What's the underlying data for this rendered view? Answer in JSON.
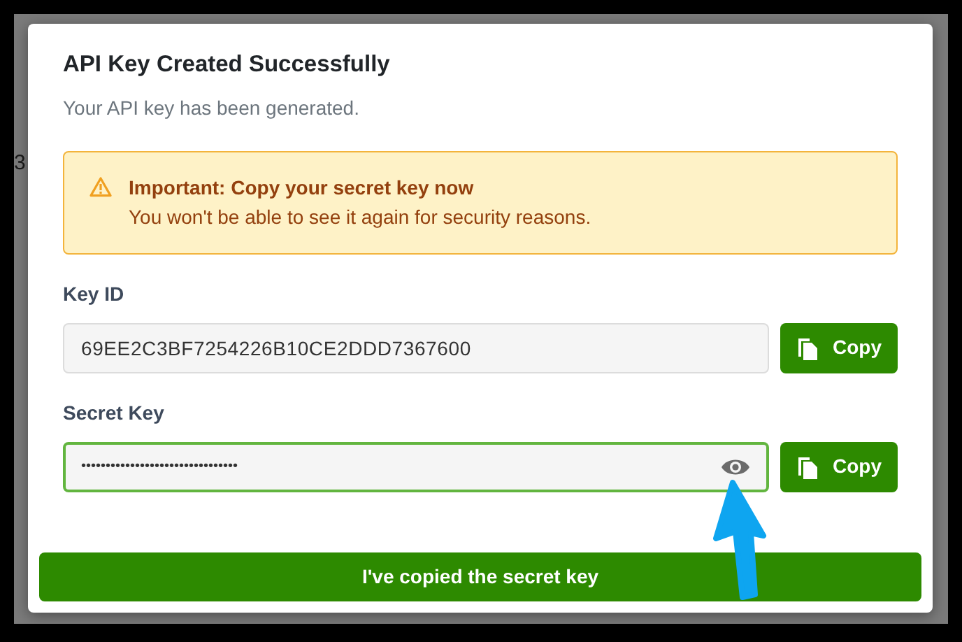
{
  "backdrop": {
    "fragment_text": "3"
  },
  "dialog": {
    "title": "API Key Created Successfully",
    "subtitle": "Your API key has been generated."
  },
  "alert": {
    "kind": "warning",
    "title": "Important: Copy your secret key now",
    "message": "You won't be able to see it again for security reasons."
  },
  "fields": [
    {
      "label": "Key ID",
      "value": "69EE2C3BF7254226B10CE2DDD7367600",
      "masked": false,
      "focused": false,
      "button": "Copy"
    },
    {
      "label": "Secret Key",
      "value": "••••••••••••••••••••••••••••••••",
      "masked": true,
      "focused": true,
      "button": "Copy"
    }
  ],
  "confirm_button": "I've copied the secret key"
}
